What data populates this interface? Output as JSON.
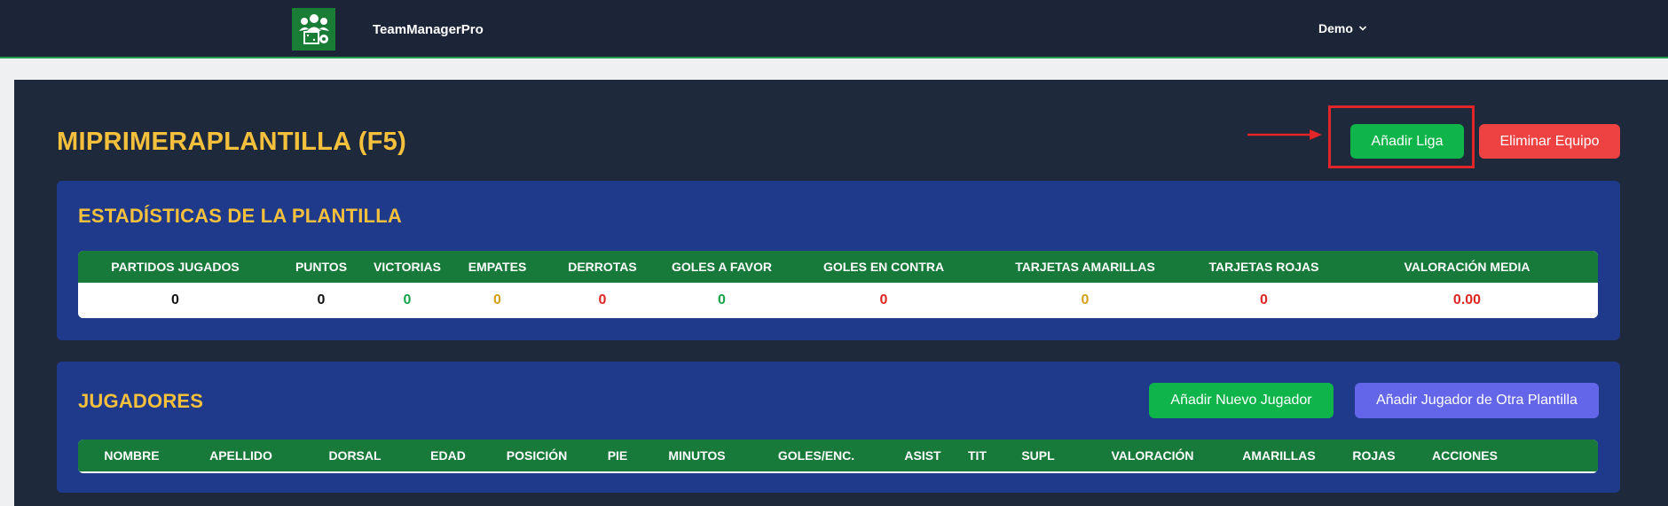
{
  "navbar": {
    "brand": "TeamManagerPro",
    "logo_icon": "team-soccer-logo-icon",
    "user": "Demo"
  },
  "team": {
    "title": "MIPRIMERAPLANTILLA (F5)"
  },
  "actions": {
    "add_league": "Añadir Liga",
    "delete_team": "Eliminar Equipo"
  },
  "stats": {
    "title": "ESTADÍSTICAS DE LA PLANTILLA",
    "columns": [
      {
        "label": "PARTIDOS JUGADOS",
        "value": "0",
        "color": "#111111"
      },
      {
        "label": "PUNTOS",
        "value": "0",
        "color": "#111111"
      },
      {
        "label": "VICTORIAS",
        "value": "0",
        "color": "#16a34a"
      },
      {
        "label": "EMPATES",
        "value": "0",
        "color": "#d4a017"
      },
      {
        "label": "DERROTAS",
        "value": "0",
        "color": "#dc2626"
      },
      {
        "label": "GOLES A FAVOR",
        "value": "0",
        "color": "#16a34a"
      },
      {
        "label": "GOLES EN CONTRA",
        "value": "0",
        "color": "#dc2626"
      },
      {
        "label": "TARJETAS AMARILLAS",
        "value": "0",
        "color": "#d4a017"
      },
      {
        "label": "TARJETAS ROJAS",
        "value": "0",
        "color": "#dc2626"
      },
      {
        "label": "VALORACIÓN MEDIA",
        "value": "0.00",
        "color": "#dc2626"
      }
    ]
  },
  "players": {
    "title": "JUGADORES",
    "add_new": "Añadir Nuevo Jugador",
    "add_other": "Añadir Jugador de Otra Plantilla",
    "columns": [
      "NOMBRE",
      "APELLIDO",
      "DORSAL",
      "EDAD",
      "POSICIÓN",
      "PIE",
      "MINUTOS",
      "GOLES/ENC.",
      "ASIST",
      "TIT",
      "SUPL",
      "VALORACIÓN",
      "AMARILLAS",
      "ROJAS",
      "ACCIONES"
    ]
  }
}
